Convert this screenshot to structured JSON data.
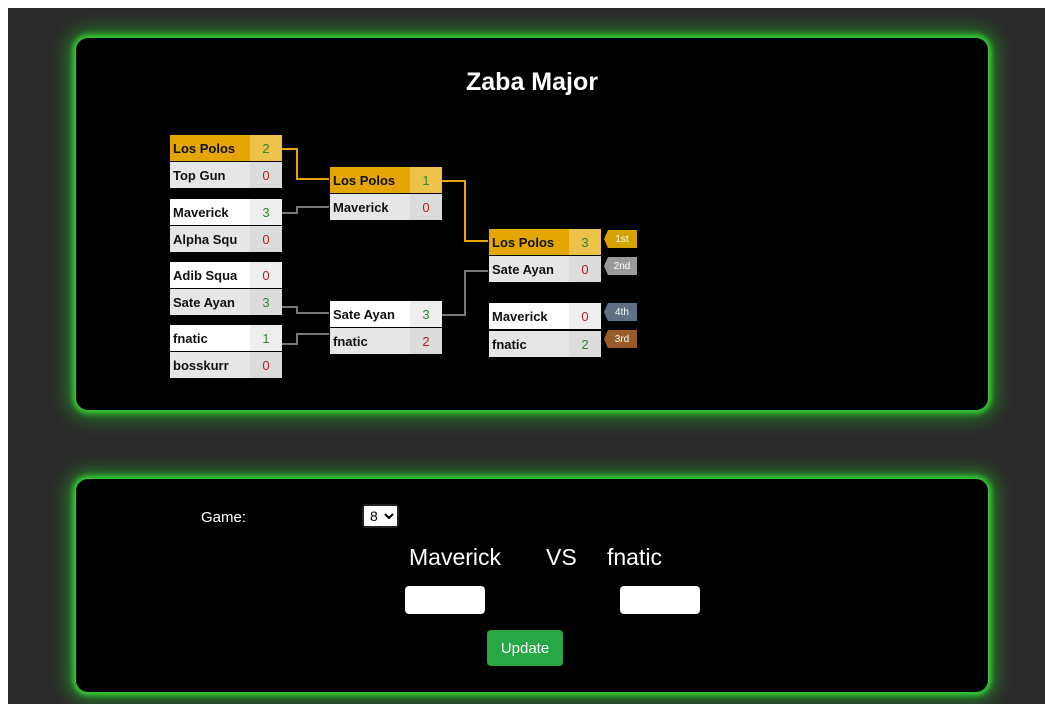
{
  "title": "Zaba Major",
  "bracket": {
    "round1": [
      {
        "name": "Los Polos",
        "score": "2"
      },
      {
        "name": "Top Gun",
        "score": "0"
      },
      {
        "name": "Maverick",
        "score": "3"
      },
      {
        "name": "Alpha Squ",
        "score": "0"
      },
      {
        "name": "Adib Squa",
        "score": "0"
      },
      {
        "name": "Sate Ayan",
        "score": "3"
      },
      {
        "name": "fnatic",
        "score": "1"
      },
      {
        "name": "bosskurr",
        "score": "0"
      }
    ],
    "round2": [
      {
        "name": "Los Polos",
        "score": "1"
      },
      {
        "name": "Maverick",
        "score": "0"
      },
      {
        "name": "Sate Ayan",
        "score": "3"
      },
      {
        "name": "fnatic",
        "score": "2"
      }
    ],
    "final": [
      {
        "name": "Los Polos",
        "score": "3"
      },
      {
        "name": "Sate Ayan",
        "score": "0"
      }
    ],
    "third_place": [
      {
        "name": "Maverick",
        "score": "0"
      },
      {
        "name": "fnatic",
        "score": "2"
      }
    ],
    "places": {
      "first": "1st",
      "second": "2nd",
      "fourth": "4th",
      "third": "3rd"
    }
  },
  "form": {
    "game_label": "Game:",
    "game_value": "8",
    "team_a": "Maverick",
    "vs": "VS",
    "team_b": "fnatic",
    "update_label": "Update"
  },
  "colors": {
    "gold": "#e3a605",
    "win_green": "#2d8a2d",
    "loss_red": "#b22222",
    "button_green": "#28a745",
    "glow": "#37d837"
  }
}
